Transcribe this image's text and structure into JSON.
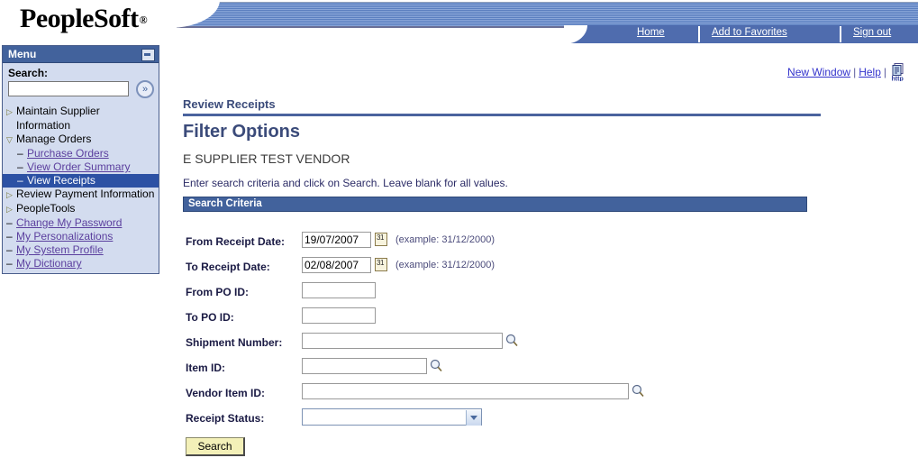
{
  "header": {
    "logo_text": "PeopleSoft",
    "logo_registered": "®",
    "nav_links": [
      {
        "label": "Home",
        "name": "nav-home"
      },
      {
        "label": "Add to Favorites",
        "name": "nav-add-to-favorites"
      },
      {
        "label": "Sign out",
        "name": "nav-sign-out"
      }
    ]
  },
  "toolbar": {
    "new_window": "New Window",
    "help": "Help",
    "separator": "|",
    "http_icon_label": "http"
  },
  "sidebar": {
    "title": "Menu",
    "minimize_icon": "minimize-icon",
    "search_label": "Search:",
    "search_value": "",
    "search_placeholder": "",
    "go_icon": "»",
    "items": [
      {
        "label": "Maintain Supplier",
        "type": "folder",
        "marker": "▷",
        "name": "menu-item-maintain-supplier-information"
      },
      {
        "label": "Information",
        "type": "wrapped",
        "marker": "",
        "name": "menu-item-maintain-supplier-information-line2"
      },
      {
        "label": "Manage Orders",
        "type": "folder-open",
        "marker": "▽",
        "name": "menu-item-manage-orders"
      },
      {
        "label": "Purchase Orders",
        "type": "child-link",
        "marker": "–",
        "name": "menu-item-purchase-orders"
      },
      {
        "label": "View Order Summary",
        "type": "child-link",
        "marker": "–",
        "name": "menu-item-view-order-summary"
      },
      {
        "label": "View Receipts",
        "type": "child-selected",
        "marker": "–",
        "name": "menu-item-view-receipts"
      },
      {
        "label": "Review Payment Information",
        "type": "folder",
        "marker": "▷",
        "name": "menu-item-review-payment-information"
      },
      {
        "label": "PeopleTools",
        "type": "folder",
        "marker": "▷",
        "name": "menu-item-peopletools"
      },
      {
        "label": "Change My Password",
        "type": "leaf-link",
        "marker": "–",
        "name": "menu-item-change-my-password"
      },
      {
        "label": "My Personalizations",
        "type": "leaf-link",
        "marker": "–",
        "name": "menu-item-my-personalizations"
      },
      {
        "label": "My System Profile",
        "type": "leaf-link",
        "marker": "–",
        "name": "menu-item-my-system-profile"
      },
      {
        "label": "My Dictionary",
        "type": "leaf-link",
        "marker": "–",
        "name": "menu-item-my-dictionary"
      }
    ]
  },
  "main": {
    "breadcrumb": "Review Receipts",
    "page_title": "Filter Options",
    "vendor_name": "E SUPPLIER TEST VENDOR",
    "instructions": "Enter search criteria and click on Search. Leave blank for all values.",
    "section_header": "Search Criteria",
    "fields": {
      "from_receipt_date": {
        "label": "From Receipt Date:",
        "value": "19/07/2007",
        "hint": "(example: 31/12/2000)"
      },
      "to_receipt_date": {
        "label": "To Receipt Date:",
        "value": "02/08/2007",
        "hint": "(example: 31/12/2000)"
      },
      "from_po_id": {
        "label": "From PO ID:",
        "value": ""
      },
      "to_po_id": {
        "label": "To PO ID:",
        "value": ""
      },
      "shipment_number": {
        "label": "Shipment Number:",
        "value": ""
      },
      "item_id": {
        "label": "Item ID:",
        "value": ""
      },
      "vendor_item_id": {
        "label": "Vendor Item ID:",
        "value": ""
      },
      "receipt_status": {
        "label": "Receipt Status:",
        "value": "",
        "options": [
          ""
        ]
      }
    },
    "search_button": "Search"
  },
  "colors": {
    "header_blue": "#4f6cae",
    "title_navy": "#3b4b7a",
    "section_bar": "#42629c",
    "sidebar_bg": "#d3dcef",
    "selected_item": "#2c51a4",
    "link_purple": "#5b3f9e",
    "link_blue": "#3333cc",
    "button_yellow": "#f3f0b8"
  }
}
